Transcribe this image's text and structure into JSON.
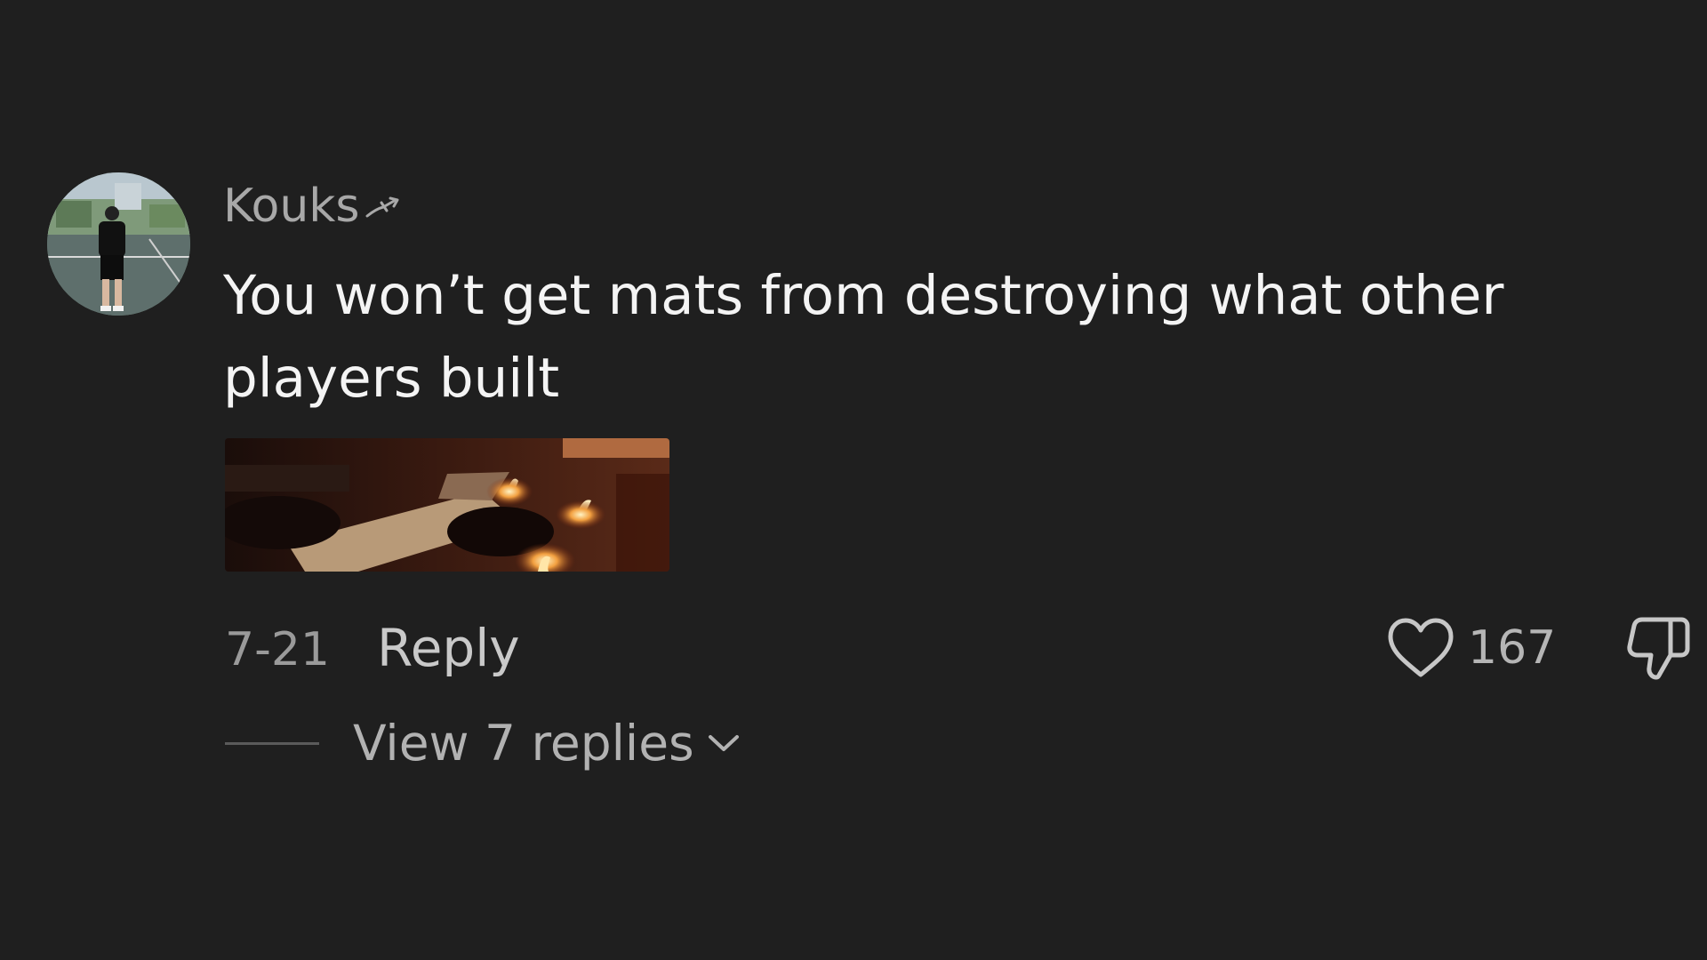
{
  "comment": {
    "username": "Kouks",
    "text": "You won’t get mats from destroying what other players built",
    "date": "7-21",
    "reply_label": "Reply",
    "like_count": "167",
    "view_replies_label": "View 7 replies",
    "icons": {
      "like": "heart-icon",
      "dislike": "thumbs-down-icon",
      "expand": "chevron-down-icon",
      "username_badge": "arrow-decoration-icon"
    }
  },
  "theme": {
    "background": "#1f1f1f",
    "text_primary": "#f4f4f4",
    "text_secondary": "#a8a8a8"
  }
}
